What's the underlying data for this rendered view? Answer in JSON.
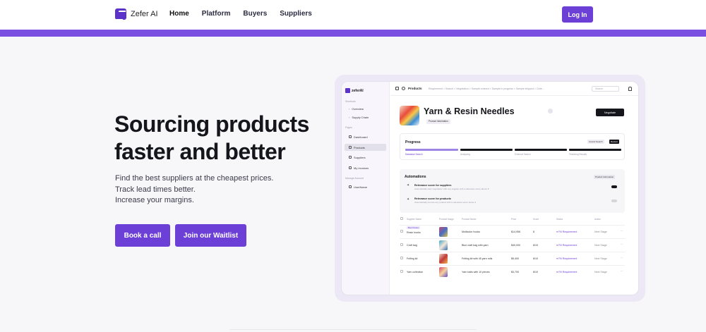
{
  "nav": {
    "brand": "Zefer AI",
    "links": [
      "Home",
      "Platform",
      "Buyers",
      "Suppliers"
    ],
    "login": "Log In"
  },
  "hero": {
    "title": "Sourcing products faster and better",
    "subtitle_lines": [
      "Find the best suppliers at the cheapest prices.",
      "Track lead times better.",
      "Increase your margins."
    ],
    "cta_primary": "Book a call",
    "cta_secondary": "Join our Waitlist"
  },
  "mockup": {
    "brand": "zeferAI",
    "sidebar": {
      "sections": [
        "Shortcuts",
        "Pages",
        "Manage Account"
      ],
      "shortcut_items": [
        "Overview",
        "Supply Chain"
      ],
      "page_items": [
        "Dashboard",
        "Products",
        "Suppliers",
        "My Invoices"
      ],
      "account_items": [
        "UserName"
      ]
    },
    "topbar": {
      "title": "Products",
      "crumbs": "Requirement > Search > Negotiation > Sample ordered > Sample in progress > Sample shipped > Orde...",
      "search_placeholder": "Search"
    },
    "product": {
      "title": "Yarn & Resin Needles",
      "chip": "Product Information",
      "negotiate": "Negotiate"
    },
    "progress": {
      "title": "Progress",
      "cancel": "Cancel Search",
      "restart": "Restart",
      "steps": [
        "Database Search",
        "Analyzing",
        "External Search",
        "Finalizing Results"
      ]
    },
    "automations": {
      "title": "Automations",
      "chip": "Product Information",
      "rows": [
        {
          "title": "Relevance score for suppliers",
          "sub": "Automatically start negotiation with any supplier with a relevance score above 8"
        },
        {
          "title": "Relevance score for products",
          "sub": "Automatically remove any product with a relevance score below 3"
        }
      ]
    },
    "table": {
      "headers": [
        "Supplier Name",
        "Product Image",
        "Product Name",
        "Price",
        "Score",
        "Status",
        "Action"
      ],
      "rows": [
        {
          "badge": "Best Choice",
          "supplier": "Resin hooks",
          "product": "Multicolor hooks",
          "price": "$14,956",
          "score": "8",
          "status": "● Fill Requirement",
          "action": "Next Stage"
        },
        {
          "badge": "",
          "supplier": "Craft bag",
          "product": "Blue craft bag with yarn",
          "price": "$40,000",
          "score": "8/10",
          "status": "● Fill Requirement",
          "action": "Next Stage"
        },
        {
          "badge": "",
          "supplier": "Felting kit",
          "product": "Felting kit with 45 yarn rolls",
          "price": "$5,400",
          "score": "8/10",
          "status": "● Fill Requirement",
          "action": "Next Stage"
        },
        {
          "badge": "",
          "supplier": "Yarn collection",
          "product": "Yarn balls with 10 pieces",
          "price": "$3,700",
          "score": "8/10",
          "status": "● Fill Requirement",
          "action": "Next Stage"
        }
      ]
    }
  },
  "colors": {
    "accent": "#6c3fd6",
    "bar": "#7b4fe0",
    "background": "#f7f6f9"
  }
}
